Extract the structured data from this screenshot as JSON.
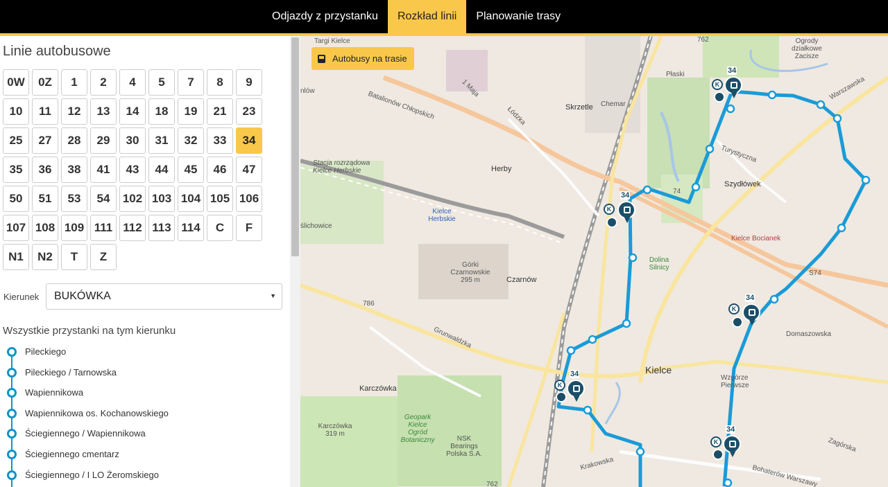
{
  "nav": {
    "items": [
      {
        "label": "Odjazdy z przystanku",
        "active": false
      },
      {
        "label": "Rozkład linii",
        "active": true
      },
      {
        "label": "Planowanie trasy",
        "active": false
      }
    ],
    "accent_color": "#f9c84a"
  },
  "sidebar": {
    "title": "Linie autobusowe",
    "lines": [
      "0W",
      "0Z",
      "1",
      "2",
      "4",
      "5",
      "7",
      "8",
      "9",
      "10",
      "11",
      "12",
      "13",
      "14",
      "18",
      "19",
      "21",
      "23",
      "25",
      "27",
      "28",
      "29",
      "30",
      "31",
      "32",
      "33",
      "34",
      "35",
      "36",
      "38",
      "41",
      "43",
      "44",
      "45",
      "46",
      "47",
      "50",
      "51",
      "53",
      "54",
      "102",
      "103",
      "104",
      "105",
      "106",
      "107",
      "108",
      "109",
      "111",
      "112",
      "113",
      "114",
      "C",
      "F",
      "N1",
      "N2",
      "T",
      "Z"
    ],
    "selected_line": "34",
    "direction_label": "Kierunek",
    "direction_value": "BUKÓWKA",
    "stops_title": "Wszystkie przystanki na tym kierunku",
    "stops": [
      "Pileckiego",
      "Pileckiego / Tarnowska",
      "Wapiennikowa",
      "Wapiennikowa os. Kochanowskiego",
      "Ściegiennego / Wapiennikowa",
      "Ściegiennego cmentarz",
      "Ściegiennego / I LO Żeromskiego"
    ]
  },
  "map": {
    "buses_button_label": "Autobusy na trasie",
    "route_color": "#1a9bd7",
    "labels": {
      "targi": "Targi Kielce",
      "ogrody": "Ogrody działkowe Zacisze",
      "plaski": "Płaski",
      "r762a": "762",
      "batalionow": "Batalionów Chłopskich",
      "maja1": "1 Maja",
      "lodzka": "Łódzka",
      "skrzetle": "Skrzetle",
      "chemar": "Chemar",
      "warszawska": "Warszawska",
      "turystyczna": "Turystyczna",
      "szydlowek": "Szydłówek",
      "stacja": "Stacja rozrządowa Kielce Herbskie",
      "herby": "Herby",
      "kielce_herbskie": "Kielce Herbskie",
      "r74": "74",
      "bocianek": "Kielce Bocianek",
      "s74": "S74",
      "dolina": "Dolina Silnicy",
      "gorki": "Górki Czarnowskie 295 m",
      "czarnow": "Czarnów",
      "r786": "786",
      "grunwaldzka": "Grunwaldzka",
      "domaszowska": "Domaszowska",
      "kielce": "Kielce",
      "karczowka": "Karczówka",
      "karczowka_hill": "Karczówka 319 m",
      "geopark": "Geopark Kielce Ogród Botaniczny",
      "nsk": "NSK Bearings Polska S.A.",
      "krakowska": "Krakowska",
      "r762b": "762",
      "zagorska": "Zagórska",
      "bohaterow": "Bohaterów Warszawy",
      "slichowice": "ślichowice",
      "owice": "nlów",
      "wzgorze": "Wzgórze Pierwsze"
    },
    "markers": [
      {
        "line": "34"
      },
      {
        "line": "34"
      },
      {
        "line": "34"
      },
      {
        "line": "34"
      },
      {
        "line": "34"
      }
    ],
    "k_badge": "K"
  }
}
